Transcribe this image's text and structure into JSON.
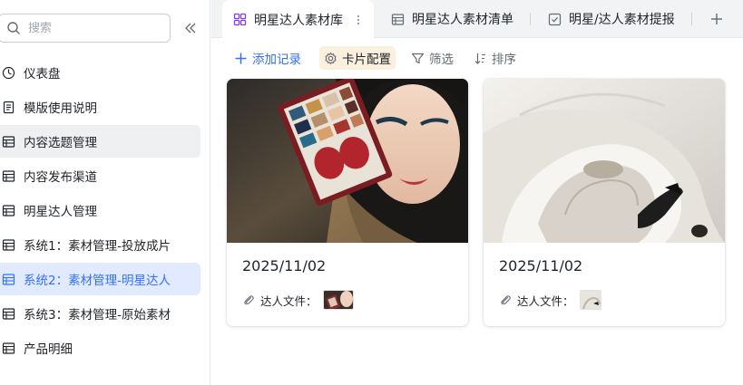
{
  "search": {
    "placeholder": "搜索"
  },
  "sidebar": {
    "items": [
      {
        "label": "仪表盘",
        "icon": "dashboard-icon"
      },
      {
        "label": "模版使用说明",
        "icon": "doc-icon"
      },
      {
        "label": "内容选题管理",
        "icon": "table-icon"
      },
      {
        "label": "内容发布渠道",
        "icon": "table-icon"
      },
      {
        "label": "明星达人管理",
        "icon": "table-icon"
      },
      {
        "label": "系统1：素材管理-投放成片",
        "icon": "table-icon"
      },
      {
        "label": "系统2：素材管理-明星达人",
        "icon": "table-icon"
      },
      {
        "label": "系统3：素材管理-原始素材",
        "icon": "table-icon"
      },
      {
        "label": "产品明细",
        "icon": "table-icon"
      }
    ],
    "hover_index": 2,
    "active_index": 6
  },
  "tabs": [
    {
      "label": "明星达人素材库",
      "icon": "gallery-view-icon"
    },
    {
      "label": "明星达人素材清单",
      "icon": "grid-view-icon"
    },
    {
      "label": "明星/达人素材提报",
      "icon": "form-view-icon"
    }
  ],
  "toolbar": {
    "add": "添加记录",
    "card_config": "卡片配置",
    "filter": "筛选",
    "sort": "排序"
  },
  "cards": [
    {
      "date": "2025/11/02",
      "field_label": "达人文件："
    },
    {
      "date": "2025/11/02",
      "field_label": "达人文件："
    }
  ],
  "colors": {
    "accent": "#3370ff",
    "active_bg": "#e1eaff",
    "hover_bg": "#eff0f1",
    "selected_tool_bg": "#fbefde",
    "tabbar_bg": "#f2f3f5"
  }
}
